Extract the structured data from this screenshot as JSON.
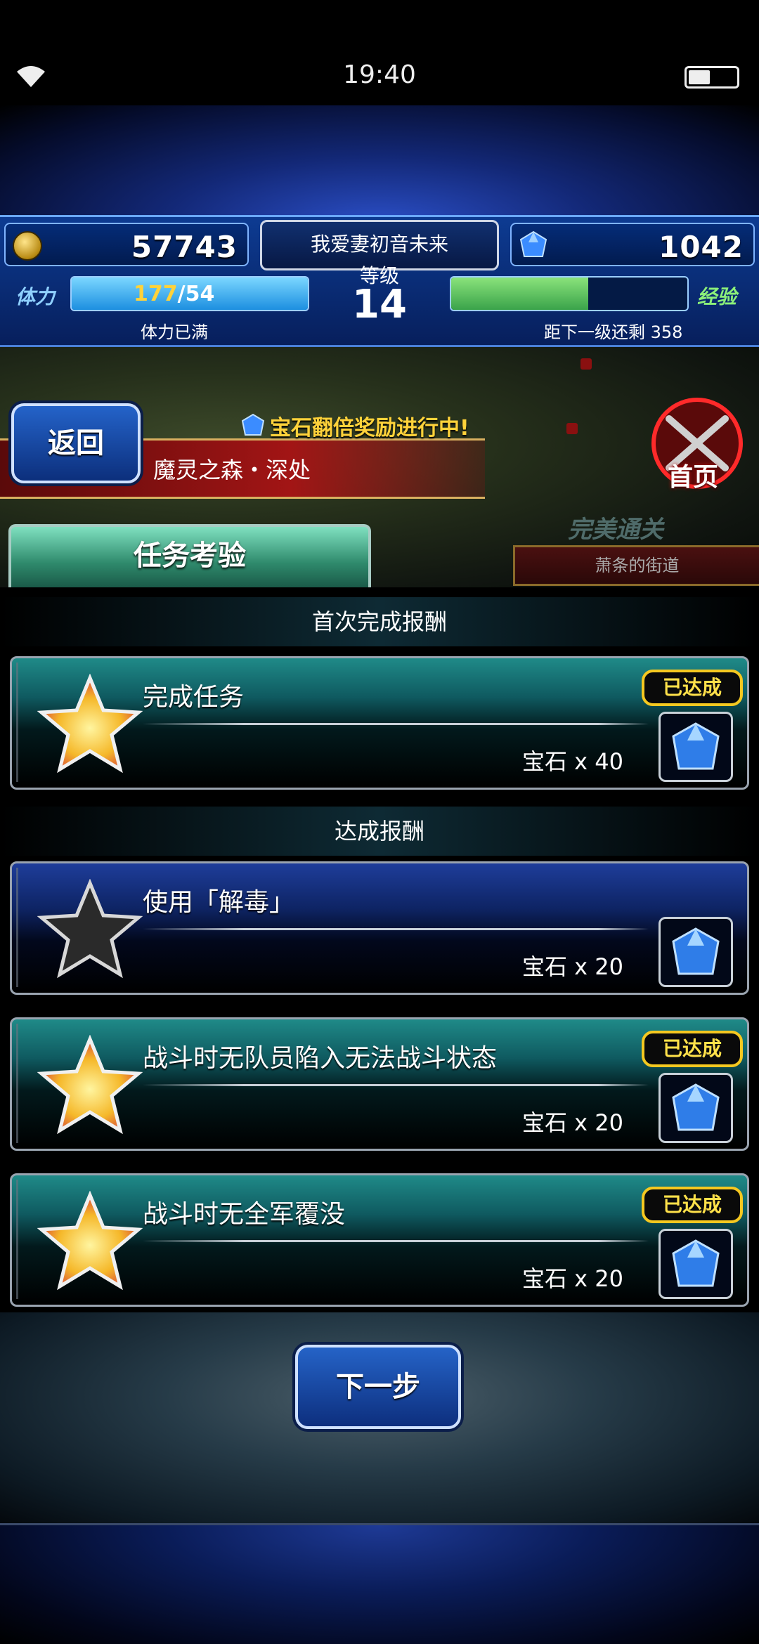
{
  "status_bar": {
    "time": "19:40"
  },
  "hud": {
    "gil": "57743",
    "player_name": "我爱妻初音未来",
    "level_label": "等级",
    "level": "14",
    "gems": "1042",
    "stamina_label": "体力",
    "stamina_current": "177",
    "stamina_max": "/54",
    "stamina_status": "体力已满",
    "stamina_fill_fraction": 1.0,
    "exp_label": "经验",
    "exp_remaining_text": "距下一级还剩 358",
    "exp_fill_fraction": 0.58
  },
  "map": {
    "back_label": "返回",
    "promo_text": "宝石翻倍奖励进行中!",
    "area_name": "魔灵之森・深处",
    "home_label": "首页",
    "perfect_text": "完美通关",
    "next_area": "萧条的街道",
    "tab_label": "任务考验"
  },
  "rewards": {
    "first_clear_title": "首次完成报酬",
    "achievement_title": "达成报酬",
    "achieved_badge": "已达成",
    "first_clear": [
      {
        "title": "完成任务",
        "reward": "宝石 x 40",
        "achieved": true
      }
    ],
    "missions": [
      {
        "title": "使用「解毒」",
        "reward": "宝石 x 20",
        "achieved": false
      },
      {
        "title": "战斗时无队员陷入无法战斗状态",
        "reward": "宝石 x 20",
        "achieved": true
      },
      {
        "title": "战斗时无全军覆没",
        "reward": "宝石 x 20",
        "achieved": true
      }
    ]
  },
  "footer": {
    "next_label": "下一步"
  },
  "colors": {
    "achieved_star": "#f2c94c",
    "badge_border": "#f5c820",
    "accent_blue": "#2463c9"
  }
}
